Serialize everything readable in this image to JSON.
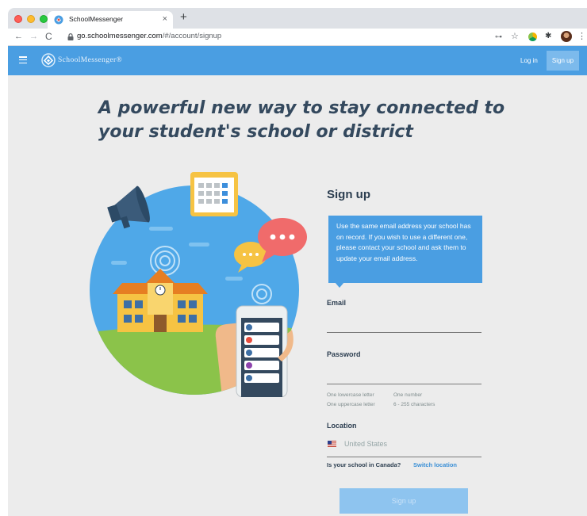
{
  "browser": {
    "tab_title": "SchoolMessenger",
    "tab_close": "×",
    "new_tab": "+",
    "url_host": "go.schoolmessenger.com",
    "url_path": "/#/account/signup"
  },
  "header": {
    "logo_text": "SchoolMessenger®",
    "login_label": "Log in",
    "signup_label": "Sign up",
    "accent_color": "#4a9ee2"
  },
  "hero": {
    "headline": "A powerful new way to stay connected to your student's school or district"
  },
  "form": {
    "title": "Sign up",
    "callout": "Use the same email address your school has on record. If you wish to use a different one, please contact your school and ask them to update your email address.",
    "email_label": "Email",
    "email_value": "",
    "password_label": "Password",
    "password_value": "",
    "password_rules": [
      "One lowercase letter",
      "One number",
      "One uppercase letter",
      "6 - 255 characters"
    ],
    "location_label": "Location",
    "location_value": "United States",
    "canada_question": "Is your school in Canada?",
    "switch_location": "Switch location",
    "submit_label": "Sign up"
  },
  "icons": [
    "back-icon",
    "forward-icon",
    "reload-icon",
    "lock-icon",
    "key-icon",
    "star-icon",
    "extension-icon",
    "puzzle-icon",
    "profile-icon",
    "menu-icon",
    "hamburger-icon",
    "flag-us-icon"
  ]
}
